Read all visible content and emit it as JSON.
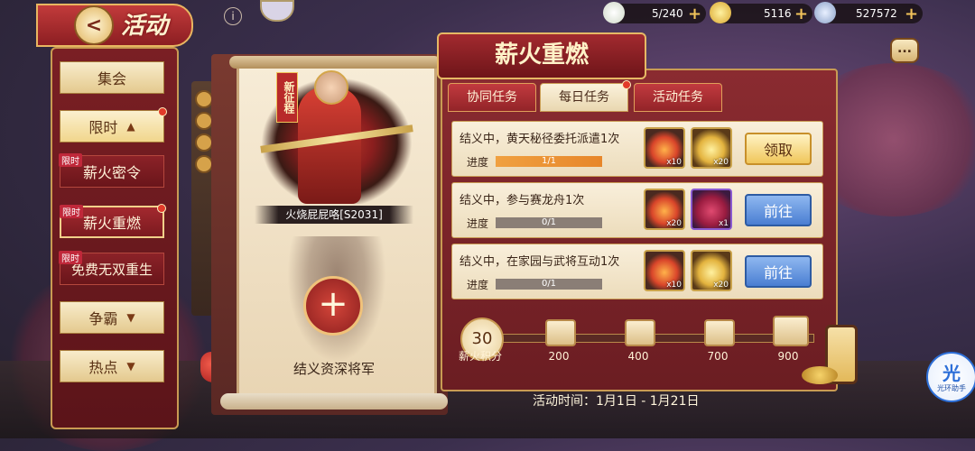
{
  "header": {
    "title": "活动",
    "back_glyph": "<"
  },
  "resources": [
    {
      "icon": "stamina-bun-icon",
      "value": "5/240"
    },
    {
      "icon": "gold-ingot-icon",
      "value": "5116"
    },
    {
      "icon": "silver-coin-icon",
      "value": "527572"
    }
  ],
  "sidebar": {
    "items": [
      {
        "label": "集会",
        "type": "category"
      },
      {
        "label": "限时",
        "type": "category-open"
      },
      {
        "label": "薪火密令",
        "tag": "限时",
        "type": "sub"
      },
      {
        "label": "薪火重燃",
        "tag": "限时",
        "type": "sub-active"
      },
      {
        "label": "免费无双重生",
        "tag": "限时",
        "type": "sub"
      },
      {
        "label": "争霸",
        "type": "category"
      },
      {
        "label": "热点",
        "type": "category"
      }
    ]
  },
  "hero": {
    "new_tag": "新征程",
    "name": "火烧屁屁咯[S2031]",
    "empty_slot_label": "结义资深将军",
    "plus_glyph": "+"
  },
  "event": {
    "title": "薪火重燃",
    "tabs": [
      {
        "label": "协同任务",
        "active": false
      },
      {
        "label": "每日任务",
        "active": true
      },
      {
        "label": "活动任务",
        "active": false
      }
    ],
    "progress_label": "进度",
    "tasks": [
      {
        "text": "结义中，黄天秘径委托派遣1次",
        "progress_text": "1/1",
        "progress_fraction": 1.0,
        "rewards": [
          {
            "icon": "fire-icon",
            "qty": "x10"
          },
          {
            "icon": "gold-ingot-icon",
            "qty": "x20"
          }
        ],
        "button": "领取",
        "button_type": "claim"
      },
      {
        "text": "结义中，参与赛龙舟1次",
        "progress_text": "0/1",
        "progress_fraction": 0.0,
        "rewards": [
          {
            "icon": "fire-icon",
            "qty": "x20"
          },
          {
            "icon": "gift-box-icon",
            "qty": "x1"
          }
        ],
        "button": "前往",
        "button_type": "go"
      },
      {
        "text": "结义中，在家园与武将互动1次",
        "progress_text": "0/1",
        "progress_fraction": 0.0,
        "rewards": [
          {
            "icon": "fire-icon",
            "qty": "x10"
          },
          {
            "icon": "gold-ingot-icon",
            "qty": "x20"
          }
        ],
        "button": "前往",
        "button_type": "go"
      }
    ],
    "points": {
      "current": "30",
      "label": "薪火积分",
      "milestones": [
        "200",
        "400",
        "700",
        "900"
      ]
    },
    "date_text": "活动时间：1月1日 - 1月21日"
  },
  "floating": {
    "assistant_glyph": "光",
    "assistant_label": "光环助手",
    "chat_glyph": "..."
  },
  "colors": {
    "primary_red": "#8a2b30",
    "gold_border": "#c99b53",
    "go_blue": "#4a7ed2",
    "progress_orange": "#e7862a"
  }
}
